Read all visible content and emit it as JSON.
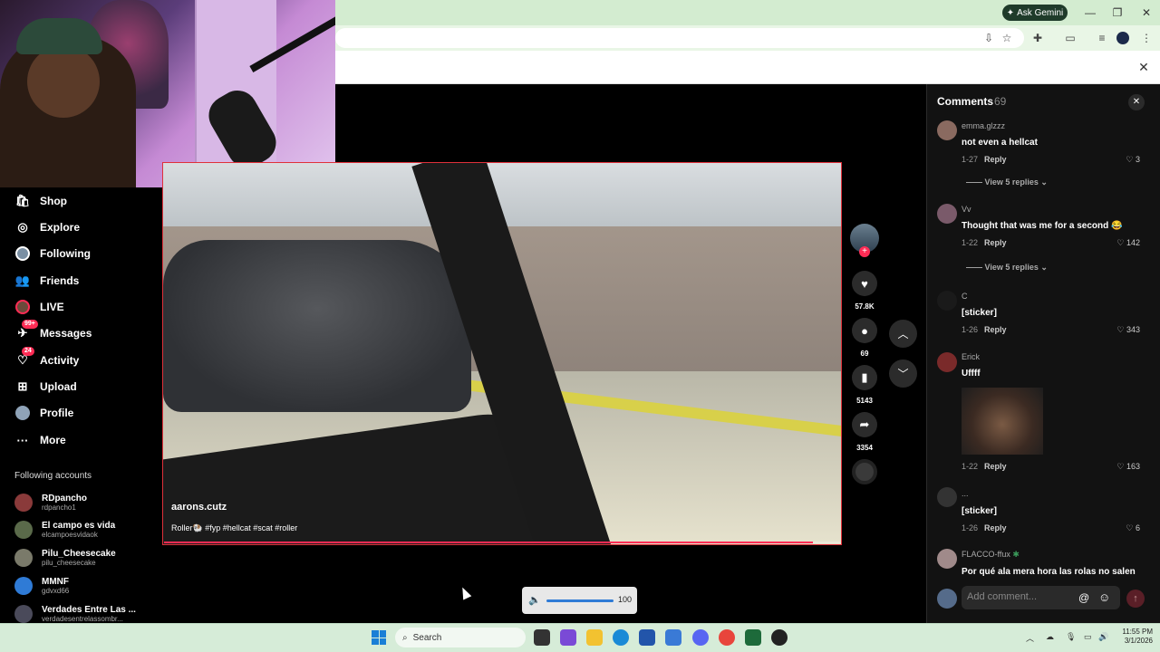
{
  "browser": {
    "gemini_label": "Ask Gemini"
  },
  "sidebar": {
    "items": [
      {
        "label": "Shop",
        "icon": "shop-icon"
      },
      {
        "label": "Explore",
        "icon": "compass-icon"
      },
      {
        "label": "Following",
        "icon": "avatar-icon"
      },
      {
        "label": "Friends",
        "icon": "friends-icon"
      },
      {
        "label": "LIVE",
        "icon": "live-icon"
      },
      {
        "label": "Messages",
        "icon": "messages-icon",
        "badge": "99+"
      },
      {
        "label": "Activity",
        "icon": "activity-icon",
        "badge": "24"
      },
      {
        "label": "Upload",
        "icon": "upload-icon"
      },
      {
        "label": "Profile",
        "icon": "profile-icon"
      },
      {
        "label": "More",
        "icon": "more-icon"
      }
    ],
    "following_title": "Following accounts",
    "accounts": [
      {
        "name": "RDpancho",
        "handle": "rdpancho1"
      },
      {
        "name": "El campo es vida",
        "handle": "elcampoesvidaok"
      },
      {
        "name": "Pilu_Cheesecake",
        "handle": "pilu_cheesecake"
      },
      {
        "name": "MMNF",
        "handle": "gdvxd66"
      },
      {
        "name": "Verdades Entre Las ...",
        "handle": "verdadesentrelassombr..."
      }
    ]
  },
  "video": {
    "username": "aarons.cutz",
    "caption": "Roller🐏 #fyp #hellcat #scat #roller",
    "progress": 0.96
  },
  "actions": {
    "likes": "57.8K",
    "comments": "69",
    "saves": "5143",
    "shares": "3354"
  },
  "comments": {
    "title": "Comments",
    "count": "69",
    "items": [
      {
        "user": "emma.glzzz",
        "text": "not even a hellcat",
        "time": "1-27",
        "reply": "Reply",
        "likes": "3",
        "view_replies": "View 5 replies"
      },
      {
        "user": "Vv",
        "text": "Thought that was me for a second 😂",
        "time": "1-22",
        "reply": "Reply",
        "likes": "142",
        "view_replies": "View 5 replies"
      },
      {
        "user": "C",
        "text": "[sticker]",
        "time": "1-26",
        "reply": "Reply",
        "likes": "343"
      },
      {
        "user": "Erick",
        "text": "Uffff",
        "time": "1-22",
        "reply": "Reply",
        "likes": "163"
      },
      {
        "user": "...",
        "text": "[sticker]",
        "time": "1-26",
        "reply": "Reply",
        "likes": "6"
      },
      {
        "user": "FLACCO-ffux",
        "text": "Por qué ala mera hora las rolas no salen"
      }
    ],
    "placeholder": "Add comment..."
  },
  "volume": {
    "value": "100"
  },
  "taskbar": {
    "search_label": "Search",
    "time": "11:55 PM",
    "date": "3/1/2026"
  },
  "colors": {
    "accent": "#fe2c55",
    "chrome_green": "#d3ecd0",
    "panel": "#121212"
  }
}
